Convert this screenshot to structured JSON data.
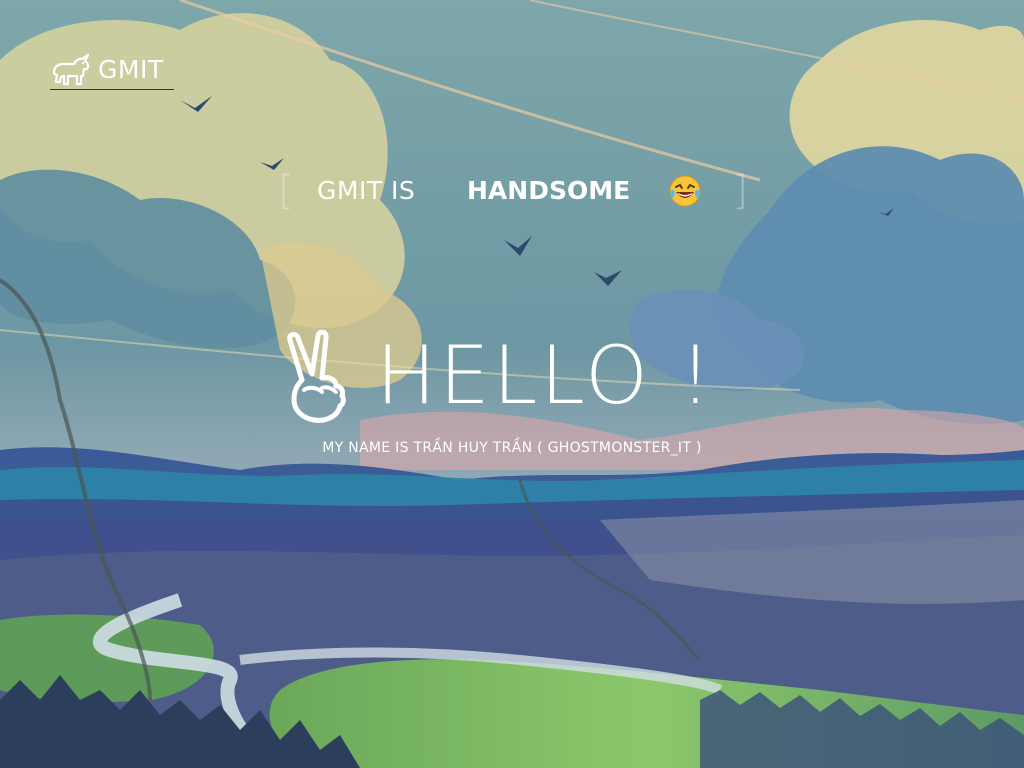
{
  "header": {
    "logo_text": "GMIT",
    "logo_icon": "unicorn-icon"
  },
  "typing": {
    "open_bracket": "[",
    "prefix": "GMIT IS",
    "word": "HANDSOME",
    "emoji_icon": "laughing-tears-icon",
    "close_bracket": "]"
  },
  "hero": {
    "icon": "peace-hand-icon",
    "title": "HELLO !",
    "subtitle": "MY NAME IS TRẦN HUY TRẦN ( GHOSTMONSTER_IT )"
  },
  "colors": {
    "text": "#ffffff",
    "sky": "#6f9aa6",
    "cloud": "#e2d9a0",
    "mountain": "#3f62a0",
    "valley": "#78b560",
    "river": "#c9d7e0"
  }
}
